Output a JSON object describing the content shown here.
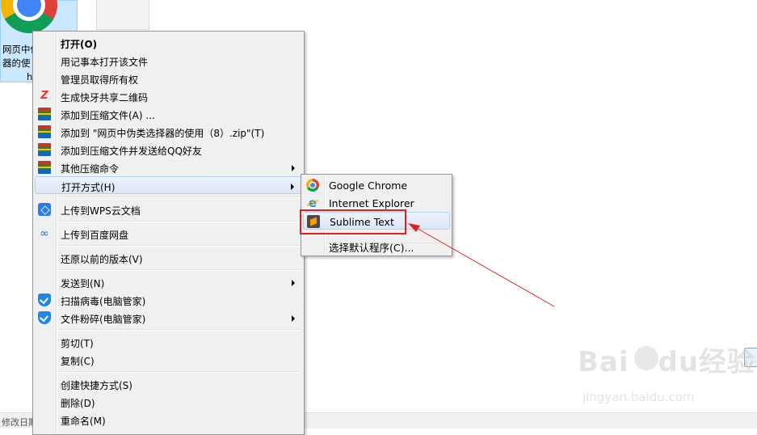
{
  "file": {
    "name_line1": "网页中伪",
    "name_line2": "器的使",
    "name_line3": "ht"
  },
  "statusbar": {
    "label": "修改日期"
  },
  "context_menu": {
    "items": [
      {
        "label": "打开(O)",
        "bold": true
      },
      {
        "label": "用记事本打开该文件"
      },
      {
        "label": "管理员取得所有权"
      },
      {
        "label": "生成快牙共享二维码",
        "icon": "kuaiya-icon"
      },
      {
        "label": "添加到压缩文件(A) ...",
        "icon": "winrar-icon"
      },
      {
        "label": "添加到 \"网页中伪类选择器的使用（8）.zip\"(T)",
        "icon": "winrar-icon"
      },
      {
        "label": "添加到压缩文件并发送给QQ好友",
        "icon": "winrar-icon"
      },
      {
        "label": "其他压缩命令",
        "icon": "winrar-icon",
        "submenu": true
      },
      {
        "label": "打开方式(H)",
        "submenu": true,
        "highlighted": true
      },
      {
        "label": "上传到WPS云文档",
        "icon": "wps-cloud-icon"
      },
      {
        "label": "上传到百度网盘",
        "icon": "baidu-netdisk-icon"
      },
      {
        "label": "还原以前的版本(V)"
      },
      {
        "label": "发送到(N)",
        "submenu": true
      },
      {
        "label": "扫描病毒(电脑管家)",
        "icon": "tencent-pcmgr-icon"
      },
      {
        "label": "文件粉碎(电脑管家)",
        "icon": "tencent-pcmgr-icon",
        "submenu": true
      },
      {
        "label": "剪切(T)"
      },
      {
        "label": "复制(C)"
      },
      {
        "label": "创建快捷方式(S)"
      },
      {
        "label": "删除(D)"
      },
      {
        "label": "重命名(M)"
      }
    ]
  },
  "open_with_menu": {
    "items": [
      {
        "label": "Google Chrome",
        "icon": "chrome-icon"
      },
      {
        "label": "Internet Explorer",
        "icon": "ie-icon"
      },
      {
        "label": "Sublime Text",
        "icon": "sublime-icon",
        "highlighted": true
      },
      {
        "label": "选择默认程序(C)..."
      }
    ]
  },
  "watermark": {
    "brand": "Bai",
    "brand2": "du",
    "brand3": "经验",
    "sub": "jingyan.baidu.com"
  },
  "colors": {
    "highlight_box": "#e0201c",
    "menu_bg": "#f0f0f0",
    "selection_bg": "#cce8ff"
  }
}
